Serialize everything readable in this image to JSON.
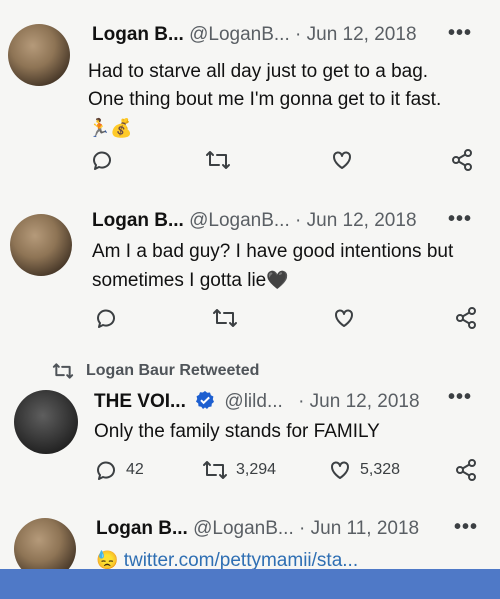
{
  "tweets": [
    {
      "name": "Logan B...",
      "handle": "@LoganB...",
      "date": "· Jun 12, 2018",
      "text_line1": "Had to starve all day just to get to a bag.",
      "text_line2": "One thing bout me I'm gonna  get to it fast.",
      "emojis": "🏃💰",
      "more_label": "•••"
    },
    {
      "name": "Logan B...",
      "handle": "@LoganB...",
      "date": "· Jun 12, 2018",
      "text_line1": "Am I a bad guy? I have good intentions but",
      "text_line2": "sometimes I gotta lie",
      "emoji_tail": "🖤",
      "more_label": "•••"
    },
    {
      "retweeted_by": "Logan Baur Retweeted",
      "name": "THE VOI...",
      "handle": "@lild...",
      "date": "· Jun 12, 2018",
      "text_line1": "Only the family stands for FAMILY",
      "replies": "42",
      "retweets": "3,294",
      "likes": "5,328",
      "more_label": "•••"
    },
    {
      "name": "Logan B...",
      "handle": "@LoganB...",
      "date": "· Jun 11, 2018",
      "link_emoji": "😓",
      "link": "twitter.com/pettymamii/sta...",
      "more_label": "•••"
    }
  ],
  "colors": {
    "link": "#2f6fb3",
    "bottom_bar": "#4f79c7"
  }
}
